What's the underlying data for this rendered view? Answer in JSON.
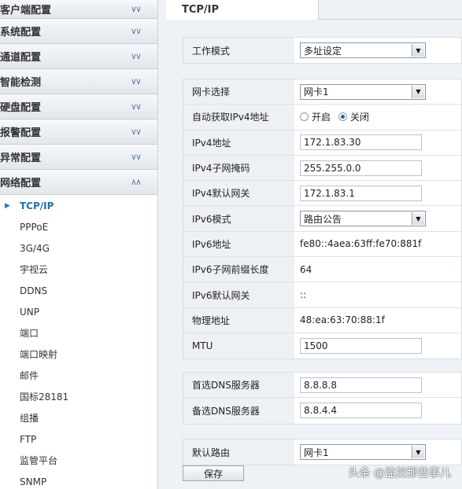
{
  "sidebar": {
    "categories": [
      {
        "label": "客户端配置"
      },
      {
        "label": "系统配置"
      },
      {
        "label": "通道配置"
      },
      {
        "label": "智能检测"
      },
      {
        "label": "硬盘配置"
      },
      {
        "label": "报警配置"
      },
      {
        "label": "异常配置"
      },
      {
        "label": "网络配置"
      }
    ],
    "subitems": [
      "TCP/IP",
      "PPPoE",
      "3G/4G",
      "宇视云",
      "DDNS",
      "UNP",
      "端口",
      "端口映射",
      "邮件",
      "国标28181",
      "组播",
      "FTP",
      "监管平台",
      "SNMP"
    ]
  },
  "tab": {
    "label": "TCP/IP"
  },
  "form": {
    "work_mode": {
      "label": "工作模式",
      "value": "多址设定"
    },
    "nic": {
      "label": "网卡选择",
      "value": "网卡1"
    },
    "auto_ipv4": {
      "label": "自动获取IPv4地址",
      "on": "开启",
      "off": "关闭"
    },
    "ipv4_addr": {
      "label": "IPv4地址",
      "value": "172.1.83.30"
    },
    "ipv4_mask": {
      "label": "IPv4子网掩码",
      "value": "255.255.0.0"
    },
    "ipv4_gw": {
      "label": "IPv4默认网关",
      "value": "172.1.83.1"
    },
    "ipv6_mode": {
      "label": "IPv6模式",
      "value": "路由公告"
    },
    "ipv6_addr": {
      "label": "IPv6地址",
      "value": "fe80::4aea:63ff:fe70:881f"
    },
    "ipv6_prefix": {
      "label": "IPv6子网前缀长度",
      "value": "64"
    },
    "ipv6_gw": {
      "label": "IPv6默认网关",
      "value": "::"
    },
    "mac": {
      "label": "物理地址",
      "value": "48:ea:63:70:88:1f"
    },
    "mtu": {
      "label": "MTU",
      "value": "1500"
    },
    "dns1": {
      "label": "首选DNS服务器",
      "value": "8.8.8.8"
    },
    "dns2": {
      "label": "备选DNS服务器",
      "value": "8.8.4.4"
    },
    "default_route": {
      "label": "默认路由",
      "value": "网卡1"
    }
  },
  "save_label": "保存",
  "watermark": "头条 @监控那些事儿",
  "colors": {
    "accent": "#1f6fb0",
    "chevron": "#5a7fa6"
  }
}
